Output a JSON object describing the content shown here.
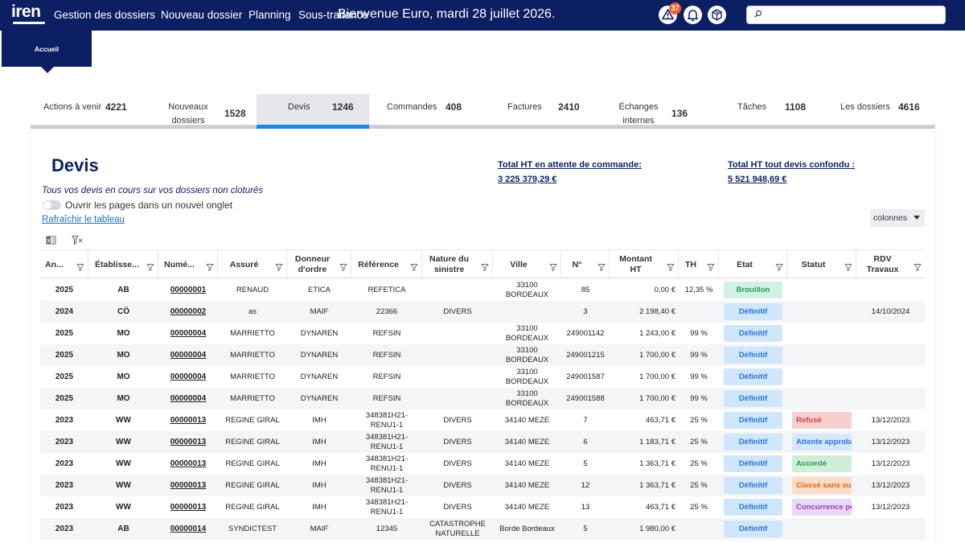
{
  "header": {
    "logo_text": "iren",
    "nav": [
      "Gestion des dossiers",
      "Nouveau dossier",
      "Planning",
      "Sous-traitance"
    ],
    "welcome": "Bienvenue Euro, mardi 28 juillet 2026.",
    "notification_count": "37",
    "search_placeholder": ""
  },
  "accueil_label": "Accueil",
  "tabs": [
    {
      "label": "Actions à venir",
      "count": "4221"
    },
    {
      "label": "Nouveaux dossiers",
      "count": "1528"
    },
    {
      "label": "Devis",
      "count": "1246"
    },
    {
      "label": "Commandes",
      "count": "408"
    },
    {
      "label": "Factures",
      "count": "2410"
    },
    {
      "label": "Échanges internes",
      "count": "136"
    },
    {
      "label": "Tâches",
      "count": "1108"
    },
    {
      "label": "Les dossiers",
      "count": "4616"
    }
  ],
  "page": {
    "title": "Devis",
    "subtitle": "Tous vos devis en cours sur vos dossiers non cloturés",
    "toggle_label": "Ouvrir les pages dans un nouvel onglet",
    "refresh_label": "Rafraîchir le tableau",
    "total_pending_label": "Total HT en attente de commande:",
    "total_pending_value": "3 225 379,29 €",
    "total_all_label": "Total HT tout devis confondu :",
    "total_all_value": "5 521 948,69 €",
    "columns_label": "colonnes"
  },
  "table": {
    "headers": [
      "An...",
      "Établisse...",
      "Numé...",
      "Assuré",
      "Donneur d'ordre",
      "Référence",
      "Nature du sinistre",
      "Ville",
      "N°",
      "Montant HT",
      "TH",
      "Etat",
      "Statut",
      "RDV Travaux"
    ],
    "rows": [
      {
        "annee": "2025",
        "etab": "AB",
        "numero": "00000001",
        "assure": "RENAUD",
        "donneur": "ETICA",
        "reference": "REFETICA",
        "nature": "",
        "ville": "33100 BORDEAUX",
        "no": "85",
        "montant": "0,00 €",
        "th": "12,35 %",
        "etat": "Brouillon",
        "statut": "",
        "rdv": ""
      },
      {
        "annee": "2024",
        "etab": "CÖ",
        "numero": "00000002",
        "assure": "as",
        "donneur": "MAIF",
        "reference": "22366",
        "nature": "DIVERS",
        "ville": "",
        "no": "3",
        "montant": "2 198,40 €",
        "th": "",
        "etat": "Définitif",
        "statut": "",
        "rdv": "14/10/2024"
      },
      {
        "annee": "2025",
        "etab": "MO",
        "numero": "00000004",
        "assure": "MARRIETTO",
        "donneur": "DYNAREN",
        "reference": "REFSIN",
        "nature": "",
        "ville": "33100 BORDEAUX",
        "no": "249001142",
        "montant": "1 243,00 €",
        "th": "99 %",
        "etat": "Définitif",
        "statut": "",
        "rdv": ""
      },
      {
        "annee": "2025",
        "etab": "MO",
        "numero": "00000004",
        "assure": "MARRIETTO",
        "donneur": "DYNAREN",
        "reference": "REFSIN",
        "nature": "",
        "ville": "33100 BORDEAUX",
        "no": "249001215",
        "montant": "1 700,00 €",
        "th": "99 %",
        "etat": "Définitif",
        "statut": "",
        "rdv": ""
      },
      {
        "annee": "2025",
        "etab": "MO",
        "numero": "00000004",
        "assure": "MARRIETTO",
        "donneur": "DYNAREN",
        "reference": "REFSIN",
        "nature": "",
        "ville": "33100 BORDEAUX",
        "no": "249001587",
        "montant": "1 700,00 €",
        "th": "99 %",
        "etat": "Définitif",
        "statut": "",
        "rdv": ""
      },
      {
        "annee": "2025",
        "etab": "MO",
        "numero": "00000004",
        "assure": "MARRIETTO",
        "donneur": "DYNAREN",
        "reference": "REFSIN",
        "nature": "",
        "ville": "33100 BORDEAUX",
        "no": "249001588",
        "montant": "1 700,00 €",
        "th": "99 %",
        "etat": "Définitif",
        "statut": "",
        "rdv": ""
      },
      {
        "annee": "2023",
        "etab": "WW",
        "numero": "00000013",
        "assure": "REGINE GIRAL",
        "donneur": "IMH",
        "reference": "348381H21-RENU1-1",
        "nature": "DIVERS",
        "ville": "34140 MEZE",
        "no": "7",
        "montant": "463,71 €",
        "th": "25 %",
        "etat": "Définitif",
        "statut": "Refusé",
        "statut_color": "#f7cfcf",
        "statut_text": "#d9413c",
        "rdv": "13/12/2023"
      },
      {
        "annee": "2023",
        "etab": "WW",
        "numero": "00000013",
        "assure": "REGINE GIRAL",
        "donneur": "IMH",
        "reference": "348381H21-RENU1-1",
        "nature": "DIVERS",
        "ville": "34140 MEZE",
        "no": "6",
        "montant": "1 183,71 €",
        "th": "25 %",
        "etat": "Définitif",
        "statut": "Attente approba",
        "statut_color": "#d4e7fb",
        "statut_text": "#2a76d2",
        "rdv": "13/12/2023"
      },
      {
        "annee": "2023",
        "etab": "WW",
        "numero": "00000013",
        "assure": "REGINE GIRAL",
        "donneur": "IMH",
        "reference": "348381H21-RENU1-1",
        "nature": "DIVERS",
        "ville": "34140 MEZE",
        "no": "5",
        "montant": "1 363,71 €",
        "th": "25 %",
        "etat": "Définitif",
        "statut": "Accordé",
        "statut_color": "#cfeed8",
        "statut_text": "#2a9a4c",
        "rdv": "13/12/2023"
      },
      {
        "annee": "2023",
        "etab": "WW",
        "numero": "00000013",
        "assure": "REGINE GIRAL",
        "donneur": "IMH",
        "reference": "348381H21-RENU1-1",
        "nature": "DIVERS",
        "ville": "34140 MEZE",
        "no": "12",
        "montant": "1 363,71 €",
        "th": "25 %",
        "etat": "Définitif",
        "statut": "Classé sans suit",
        "statut_color": "#fbdcc6",
        "statut_text": "#e06a1b",
        "rdv": "13/12/2023"
      },
      {
        "annee": "2023",
        "etab": "WW",
        "numero": "00000013",
        "assure": "REGINE GIRAL",
        "donneur": "IMH",
        "reference": "348381H21-RENU1-1",
        "nature": "DIVERS",
        "ville": "34140 MEZE",
        "no": "13",
        "montant": "463,71 €",
        "th": "25 %",
        "etat": "Définitif",
        "statut": "Concurrence pe",
        "statut_color": "#ead8f5",
        "statut_text": "#9b3fc7",
        "rdv": "13/12/2023"
      },
      {
        "annee": "2023",
        "etab": "AB",
        "numero": "00000014",
        "assure": "SYNDICTEST",
        "donneur": "MAIF",
        "reference": "12345",
        "nature": "CATASTROPHE NATURELLE",
        "ville": "Borde Bordeaux",
        "no": "5",
        "montant": "1 980,00 €",
        "th": "",
        "etat": "Définitif",
        "statut": "",
        "rdv": ""
      }
    ]
  },
  "colors": {
    "brand_navy": "#0d1f63",
    "accent_blue": "#1e88e5"
  }
}
